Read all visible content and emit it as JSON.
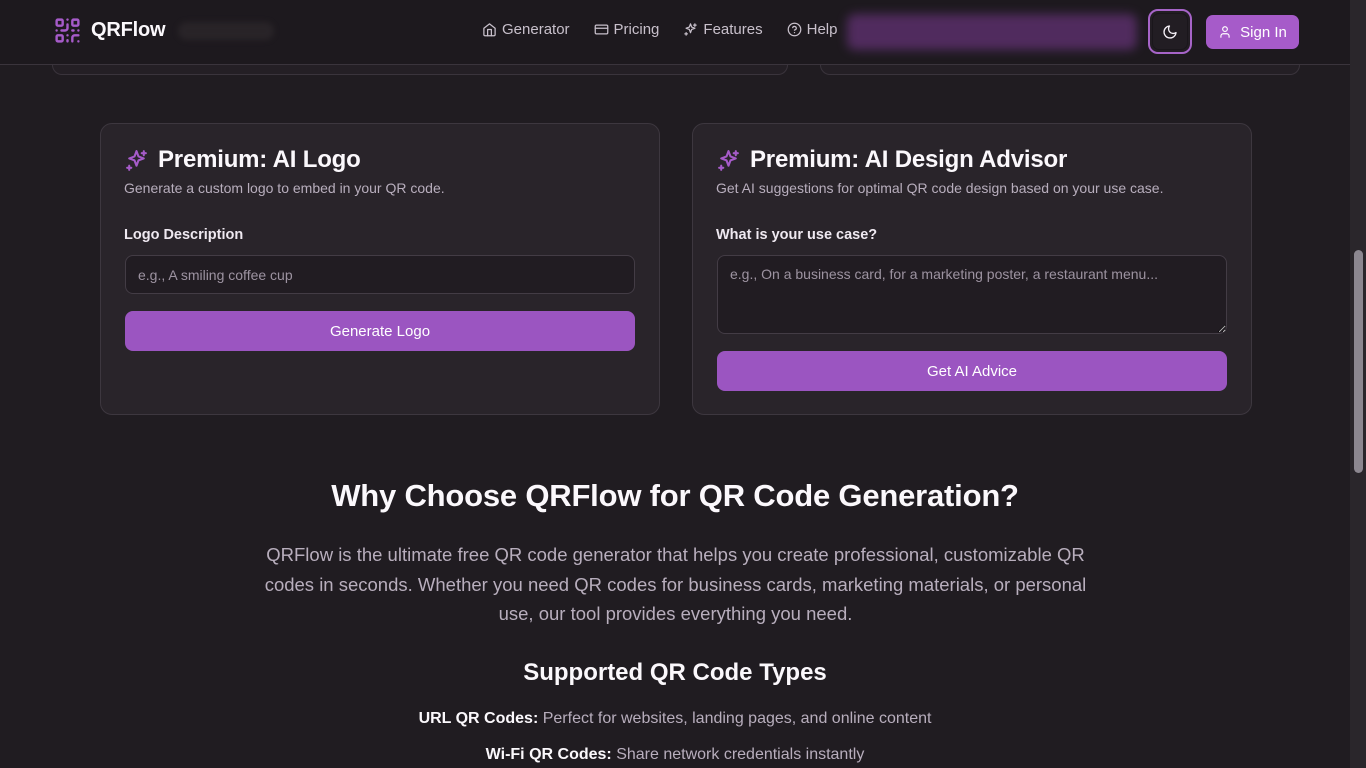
{
  "header": {
    "brand": "QRFlow",
    "nav": [
      {
        "label": "Generator",
        "icon": "home-icon"
      },
      {
        "label": "Pricing",
        "icon": "credit-card-icon"
      },
      {
        "label": "Features",
        "icon": "sparkles-icon"
      },
      {
        "label": "Help",
        "icon": "help-circle-icon"
      }
    ],
    "theme_toggle_icon": "moon-icon",
    "signin_label": "Sign In"
  },
  "logo_card": {
    "title": "Premium: AI Logo",
    "description": "Generate a custom logo to embed in your QR code.",
    "field_label": "Logo Description",
    "placeholder": "e.g., A smiling coffee cup",
    "value": "",
    "button_label": "Generate Logo"
  },
  "advisor_card": {
    "title": "Premium: AI Design Advisor",
    "description": "Get AI suggestions for optimal QR code design based on your use case.",
    "field_label": "What is your use case?",
    "placeholder": "e.g., On a business card, for a marketing poster, a restaurant menu...",
    "value": "",
    "button_label": "Get AI Advice"
  },
  "info": {
    "title": "Why Choose QRFlow for QR Code Generation?",
    "body": "QRFlow is the ultimate free QR code generator that helps you create professional, customizable QR codes in seconds. Whether you need QR codes for business cards, marketing materials, or personal use, our tool provides everything you need.",
    "types_title": "Supported QR Code Types",
    "types": [
      {
        "name": "URL QR Codes:",
        "desc": "Perfect for websites, landing pages, and online content"
      },
      {
        "name": "Wi-Fi QR Codes:",
        "desc": "Share network credentials instantly"
      }
    ]
  },
  "colors": {
    "accent": "#a65bc9",
    "button": "#9b55c1",
    "background": "#201c21",
    "card": "#29242a"
  }
}
